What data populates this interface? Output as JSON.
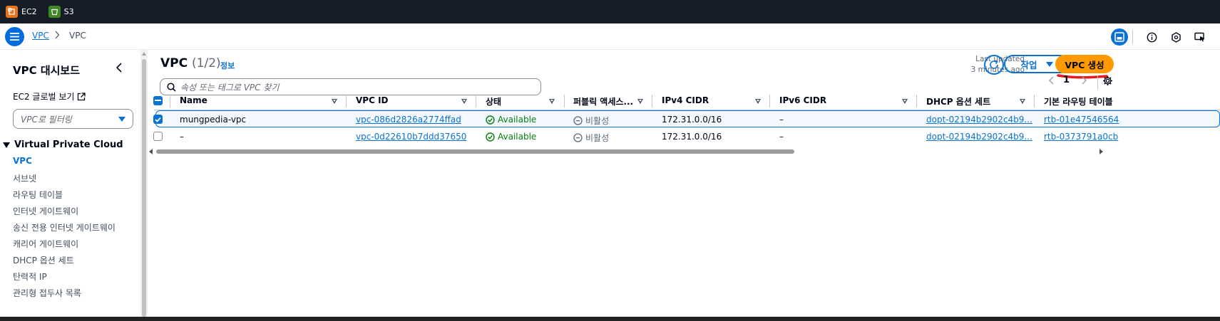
{
  "topbar": {
    "services": [
      {
        "label": "EC2",
        "icon": "ec2-service-icon",
        "color": "#e7731b"
      },
      {
        "label": "S3",
        "icon": "s3-service-icon",
        "color": "#3f8624"
      }
    ]
  },
  "breadcrumb": {
    "root": "VPC",
    "current": "VPC"
  },
  "sidebar": {
    "title": "VPC 대시보드",
    "ec2_link": "EC2 글로벌 보기",
    "filter_placeholder": "VPC로 필터링",
    "section": "Virtual Private Cloud",
    "items": [
      {
        "label": "VPC",
        "active": true
      },
      {
        "label": "서브넷"
      },
      {
        "label": "라우팅 테이블"
      },
      {
        "label": "인터넷 게이트웨이"
      },
      {
        "label": "송신 전용 인터넷 게이트웨이"
      },
      {
        "label": "캐리어 게이트웨이"
      },
      {
        "label": "DHCP 옵션 세트"
      },
      {
        "label": "탄력적 IP"
      },
      {
        "label": "관리형 접두사 목록"
      }
    ]
  },
  "main": {
    "title": "VPC",
    "count": "(1/2)",
    "info": "정보",
    "last_updated_line1": "Last updated",
    "last_updated_line2": "3 minutes ago",
    "actions_label": "작업",
    "create_label": "VPC 생성",
    "search_placeholder": "속성 또는 태그로 VPC 찾기",
    "page": "1",
    "columns": [
      "Name",
      "VPC ID",
      "상태",
      "퍼블릭 액세스...",
      "IPv4 CIDR",
      "IPv6 CIDR",
      "DHCP 옵션 세트",
      "기본 라우팅 테이블"
    ],
    "rows": [
      {
        "selected": true,
        "name": "mungpedia-vpc",
        "vpc_id": "vpc-086d2826a2774ffad",
        "status": "Available",
        "public_access": "비활성",
        "ipv4": "172.31.0.0/16",
        "ipv6": "–",
        "dhcp": "dopt-02194b2902c4b9...",
        "route_table": "rtb-01e47546564"
      },
      {
        "selected": false,
        "name": "–",
        "vpc_id": "vpc-0d22610b7ddd37650",
        "status": "Available",
        "public_access": "비활성",
        "ipv4": "172.31.0.0/16",
        "ipv6": "–",
        "dhcp": "dopt-02194b2902c4b9...",
        "route_table": "rtb-0373791a0cb"
      }
    ]
  },
  "colors": {
    "accent": "#0972d3",
    "primary_button": "#ff9900",
    "success": "#037f0c",
    "topbar": "#161d26"
  }
}
